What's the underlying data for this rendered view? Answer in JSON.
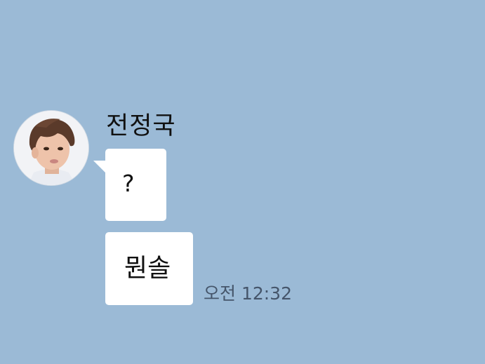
{
  "chat": {
    "sender": {
      "name": "전정국",
      "avatar": "profile-photo"
    },
    "messages": [
      {
        "text": "?"
      },
      {
        "text": "뭔솔",
        "time": "오전 12:32"
      }
    ]
  },
  "colors": {
    "background": "#9bbad6",
    "bubble": "#ffffff",
    "timestamp": "#45556a"
  }
}
